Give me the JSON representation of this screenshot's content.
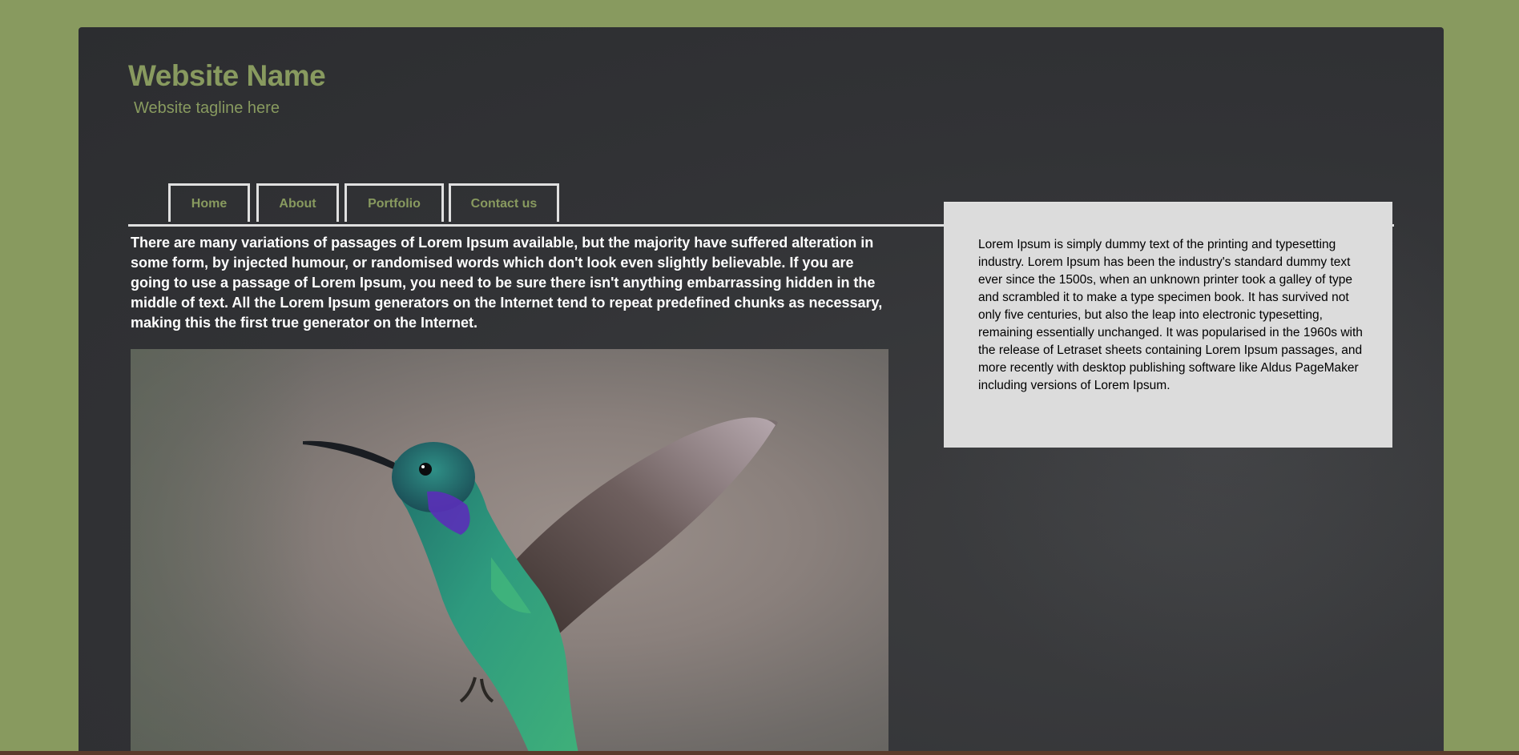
{
  "header": {
    "site_name": "Website Name",
    "tagline": "Website tagline here"
  },
  "nav": {
    "items": [
      {
        "label": "Home"
      },
      {
        "label": "About"
      },
      {
        "label": "Portfolio"
      },
      {
        "label": "Contact us"
      }
    ]
  },
  "main": {
    "intro_text": "There are many variations of passages of Lorem Ipsum available, but the majority have suffered alteration in some form, by injected humour, or randomised words which don't look even slightly believable. If you are going to use a passage of Lorem Ipsum, you need to be sure there isn't anything embarrassing hidden in the middle of text. All the Lorem Ipsum generators on the Internet tend to repeat predefined chunks as necessary, making this the first true generator on the Internet.",
    "hero_image": "hummingbird-photo"
  },
  "sidebar": {
    "text": "Lorem Ipsum is simply dummy text of the printing and typesetting industry. Lorem Ipsum has been the industry's standard dummy text ever since the 1500s, when an unknown printer took a galley of type and scrambled it to make a type specimen book. It has survived not only five centuries, but also the leap into electronic typesetting, remaining essentially unchanged. It was popularised in the 1960s with the release of Letraset sheets containing Lorem Ipsum passages, and more recently with desktop publishing software like Aldus PageMaker including versions of Lorem Ipsum."
  },
  "colors": {
    "background": "#889a5f",
    "panel": "#323336",
    "accent": "#889a5f",
    "sidebar_bg": "#dcdcdc",
    "nav_border": "#e0e0e0"
  }
}
